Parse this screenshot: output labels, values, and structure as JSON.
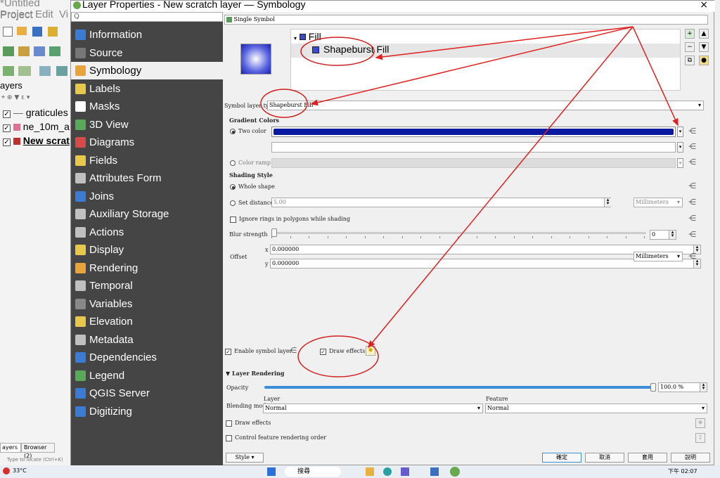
{
  "main_window": {
    "title": "*Untitled Project",
    "menu": [
      "Project",
      "Edit",
      "Vi"
    ],
    "layers_panel_title": "ayers",
    "layers": [
      {
        "name": "graticules",
        "checked": true
      },
      {
        "name": "ne_10m_a",
        "checked": true
      },
      {
        "name": "New scrat",
        "checked": true
      }
    ],
    "bottom_tabs": [
      "ayers",
      "Browser (2)"
    ],
    "locate_placeholder": "Type to locate (Ctrl+K)"
  },
  "dialog": {
    "title": "Layer Properties - New scratch layer — Symbology",
    "close": "×",
    "search_placeholder": "Q",
    "nav": [
      {
        "label": "Information",
        "icon": "info-icon",
        "color": "#3b7bd6"
      },
      {
        "label": "Source",
        "icon": "source-icon",
        "color": "#777"
      },
      {
        "label": "Symbology",
        "icon": "symbology-icon",
        "color": "#e8a33b"
      },
      {
        "label": "Labels",
        "icon": "labels-icon",
        "color": "#e8c84a"
      },
      {
        "label": "Masks",
        "icon": "masks-icon",
        "color": "#ffffff"
      },
      {
        "label": "3D View",
        "icon": "cube-icon",
        "color": "#5aa85a"
      },
      {
        "label": "Diagrams",
        "icon": "diagrams-icon",
        "color": "#d64a4a"
      },
      {
        "label": "Fields",
        "icon": "fields-icon",
        "color": "#e8c84a"
      },
      {
        "label": "Attributes Form",
        "icon": "form-icon",
        "color": "#c0c0c0"
      },
      {
        "label": "Joins",
        "icon": "joins-icon",
        "color": "#3b7bd6"
      },
      {
        "label": "Auxiliary Storage",
        "icon": "storage-icon",
        "color": "#c0c0c0"
      },
      {
        "label": "Actions",
        "icon": "actions-icon",
        "color": "#c0c0c0"
      },
      {
        "label": "Display",
        "icon": "display-icon",
        "color": "#e8c84a"
      },
      {
        "label": "Rendering",
        "icon": "rendering-icon",
        "color": "#e8a33b"
      },
      {
        "label": "Temporal",
        "icon": "clock-icon",
        "color": "#c0c0c0"
      },
      {
        "label": "Variables",
        "icon": "variables-icon",
        "color": "#888"
      },
      {
        "label": "Elevation",
        "icon": "elevation-icon",
        "color": "#e8c84a"
      },
      {
        "label": "Metadata",
        "icon": "metadata-icon",
        "color": "#c0c0c0"
      },
      {
        "label": "Dependencies",
        "icon": "dependencies-icon",
        "color": "#3b7bd6"
      },
      {
        "label": "Legend",
        "icon": "legend-icon",
        "color": "#5aa85a"
      },
      {
        "label": "QGIS Server",
        "icon": "server-icon",
        "color": "#3b7bd6"
      },
      {
        "label": "Digitizing",
        "icon": "digitizing-icon",
        "color": "#3b7bd6"
      }
    ],
    "renderer": "Single Symbol",
    "tree": {
      "root": "Fill",
      "child": "Shapeburst Fill"
    },
    "symbol_layer_type_label": "Symbol layer type",
    "symbol_layer_type_value": "Shapeburst Fill",
    "gradient_colors_label": "Gradient Colors",
    "two_color_label": "Two color",
    "color1": "#0a1aa0",
    "color_ramp_label": "Color ramp",
    "shading_style_label": "Shading Style",
    "whole_shape_label": "Whole shape",
    "set_distance_label": "Set distance",
    "set_distance_value": "5.00",
    "distance_unit": "Millimeters",
    "ignore_rings_label": "Ignore rings in polygons while shading",
    "blur_label": "Blur strength",
    "blur_value": "0",
    "offset_label": "Offset",
    "offset_x_label": "x",
    "offset_x": "0.000000",
    "offset_y_label": "y",
    "offset_y": "0.000000",
    "offset_unit": "Millimeters",
    "enable_symbol_layer": "Enable symbol layer",
    "draw_effects": "Draw effects",
    "layer_rendering": "Layer Rendering",
    "opacity_label": "Opacity",
    "opacity_value": "100.0 %",
    "opacity_level": 100,
    "blending_label": "Blending mode",
    "layer_col": "Layer",
    "feature_col": "Feature",
    "blend_layer": "Normal",
    "blend_feature": "Normal",
    "lr_draw_effects": "Draw effects",
    "control_order": "Control feature rendering order",
    "style_btn": "Style",
    "ok_btn": "確定",
    "cancel_btn": "取消",
    "apply_btn": "套用",
    "help_btn": "說明"
  },
  "taskbar": {
    "temp": "33°C",
    "search": "搜尋",
    "time": "下午 02:07"
  }
}
